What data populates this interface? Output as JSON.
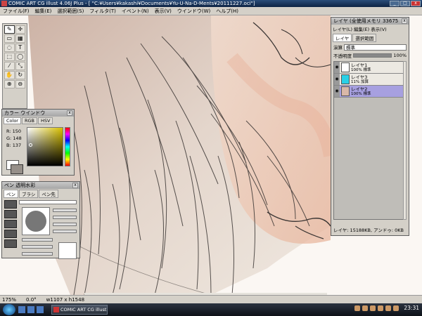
{
  "window": {
    "title": "COMIC ART CG illust 4.06J Plus - [ \"C:¥Users¥kakashi¥Documents¥Yu-U-Na-D-Ments¥20111227.oci\"]",
    "controls": [
      "_",
      "□",
      "x"
    ]
  },
  "menu": [
    "ファイル(F)",
    "編集(E)",
    "選択範囲(S)",
    "フィルタ(T)",
    "イベント(N)",
    "表示(V)",
    "ウインドウ(W)",
    "ヘルプ(H)"
  ],
  "tools": {
    "icons": [
      "pen-tool-icon",
      "move-tool-icon",
      "eraser-tool-icon",
      "fill-tool-icon",
      "lasso-tool-icon",
      "text-tool-icon",
      "rect-select-icon",
      "ellipse-select-icon",
      "eyedropper-icon",
      "transform-icon",
      "hand-icon",
      "rotate-icon",
      "zoom-in-icon",
      "zoom-out-icon"
    ],
    "glyphs": [
      "✎",
      "✛",
      "▭",
      "▦",
      "◌",
      "T",
      "⬚",
      "◯",
      "⁄",
      "⤡",
      "✋",
      "↻",
      "⊕",
      "⊖"
    ]
  },
  "color_window": {
    "title": "カラー ウインドウ",
    "tabs": [
      "Color",
      "RGB",
      "HSV"
    ],
    "active_tab": "Color",
    "r": "R: 150",
    "g": "G: 148",
    "b": "B: 137",
    "current_color": "#968F89"
  },
  "pen_window": {
    "title": "ペン 透明水彩",
    "tabs": [
      "ペン",
      "ブラシ",
      "ペン先"
    ],
    "active_tab": "ペン"
  },
  "layer_window": {
    "title": "レイヤ (全使用メモリ 33675",
    "menus": [
      "レイヤ(L)",
      "編集(E)",
      "表示(V)"
    ],
    "tabs": [
      "レイヤ",
      "選択範囲"
    ],
    "mode_label": "演算",
    "mode_value": "標準",
    "opacity_label": "不透明度",
    "opacity_value": "100%",
    "opacity_fraction": 1.0,
    "layers": [
      {
        "name": "レイヤ1",
        "mode": "100% 標準",
        "thumb": "#ffffff",
        "selected": false
      },
      {
        "name": "レイヤ3",
        "mode": "11% 加算",
        "thumb": "#2ad0e6",
        "selected": false
      },
      {
        "name": "レイヤ2",
        "mode": "100% 標準",
        "thumb": "#d9b8a8",
        "selected": true
      }
    ],
    "status": "レイヤ: 15188KB, アンドゥ: 0KB"
  },
  "statusbar": {
    "zoom": "175%",
    "angle": "0.0°",
    "size": "w1107 x h1548"
  },
  "taskbar": {
    "task_label": "COMIC ART CG illust...",
    "clock": "23:31"
  },
  "colors": {
    "skin": "#e8d4c8",
    "hair": "#d8c8bc",
    "selected_layer": "#a7a0e0"
  }
}
